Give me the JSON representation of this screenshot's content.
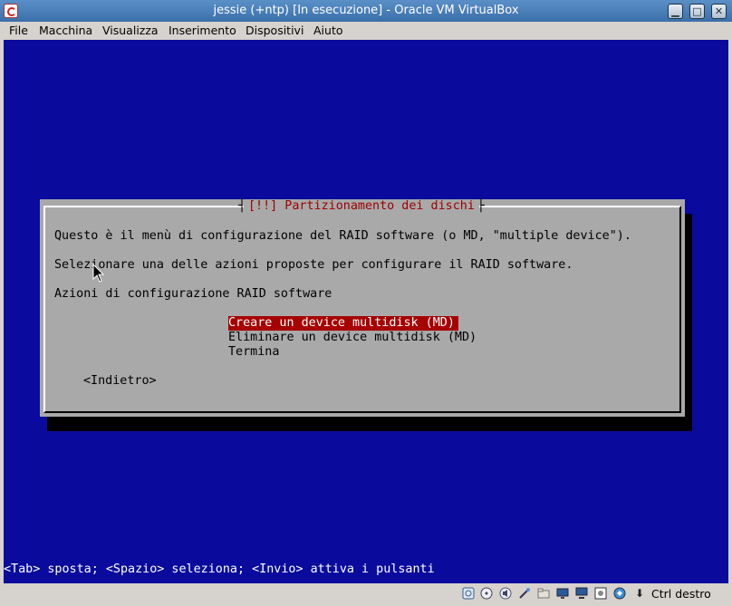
{
  "window": {
    "title": "jessie (+ntp) [In esecuzione] - Oracle VM VirtualBox",
    "minimize_label": "▁",
    "maximize_label": "□",
    "close_label": "✕"
  },
  "menu": {
    "items": [
      "File",
      "Macchina",
      "Visualizza",
      "Inserimento",
      "Dispositivi",
      "Aiuto"
    ]
  },
  "installer": {
    "dialog_title": "[!!] Partizionamento dei dischi",
    "lines": [
      "Questo è il menù di configurazione del RAID software (o MD, \"multiple device\").",
      "Selezionare una delle azioni proposte per configurare il RAID software.",
      "Azioni di configurazione RAID software"
    ],
    "options": [
      "Creare un device multidisk (MD)",
      "Eliminare un device multidisk (MD)",
      "Termina"
    ],
    "selected_option_index": 0,
    "back_button": "<Indietro>",
    "help_line": "<Tab> sposta; <Spazio> seleziona; <Invio> attiva i pulsanti",
    "colors": {
      "screen_bg": "#0a0a9c",
      "dialog_bg": "#a9a9a9",
      "title_color": "#9c0000",
      "selection_bg": "#a60000"
    }
  },
  "statusbar": {
    "icons": [
      "hard-disk-icon",
      "optical-drive-icon",
      "audio-icon",
      "usb-icon",
      "shared-folder-icon",
      "display-icon",
      "network-icon",
      "video-capture-icon",
      "cpu-virtualization-icon",
      "mouse-integration-icon"
    ],
    "host_key_label": "Ctrl destro"
  }
}
